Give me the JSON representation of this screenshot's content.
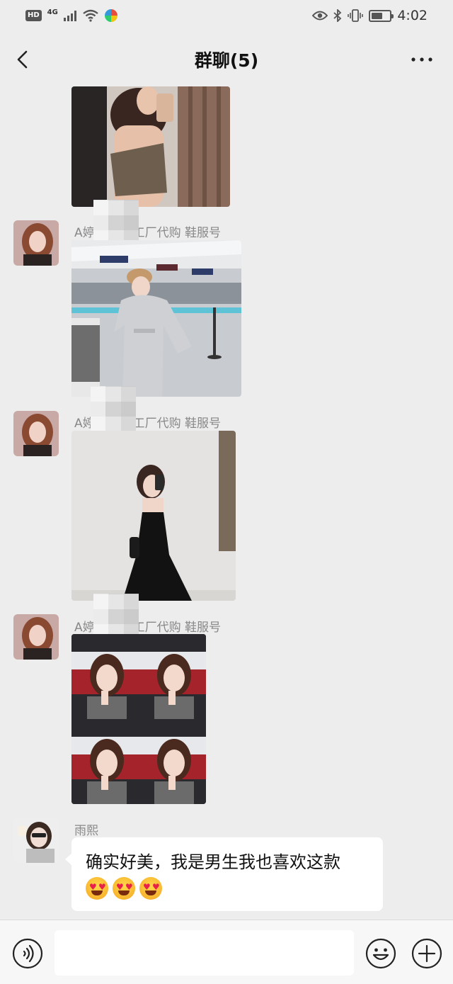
{
  "status_bar": {
    "hd": "HD",
    "network": "4G",
    "time": "4:02",
    "battery_level": 0.6,
    "icons": [
      "signal-icon",
      "wifi-icon",
      "app-icon",
      "eye-icon",
      "bluetooth-icon",
      "vibrate-icon",
      "battery-icon"
    ]
  },
  "header": {
    "title": "群聊(5)",
    "back_icon": "chevron-left-icon",
    "more_icon": "more-dots-icon"
  },
  "messages": [
    {
      "type": "image",
      "sender": "",
      "image_desc": "photo-woman-mirror-selfie"
    },
    {
      "type": "image",
      "sender_prefix": "A婷",
      "sender_suffix": "工厂代购 鞋服号",
      "image_desc": "photo-woman-grey-outfit-airport"
    },
    {
      "type": "image",
      "sender_prefix": "A婷",
      "sender_suffix": "工厂代购 鞋服号",
      "image_desc": "photo-woman-black-dress"
    },
    {
      "type": "image",
      "sender_prefix": "A婷",
      "sender_suffix": "工厂代购 鞋服号",
      "image_desc": "photo-collage-four-selfies"
    },
    {
      "type": "text",
      "sender": "雨熙",
      "text": "确实好美，我是男生我也喜欢这款",
      "emojis": [
        "heart-eyes-emoji",
        "heart-eyes-emoji",
        "heart-eyes-emoji"
      ]
    }
  ],
  "input_bar": {
    "value": "",
    "placeholder": "",
    "voice_icon": "voice-icon",
    "emoji_icon": "emoji-icon",
    "plus_icon": "plus-icon"
  },
  "colors": {
    "background": "#ededed",
    "bubble": "#ffffff",
    "name_text": "#888888"
  }
}
